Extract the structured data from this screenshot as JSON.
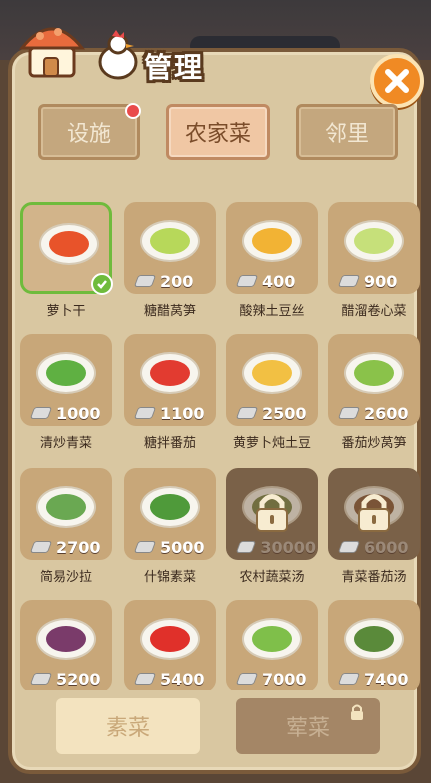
{
  "header": {
    "title": "管理",
    "close_icon": "close-icon"
  },
  "tabs": [
    {
      "label": "设施",
      "active": false,
      "has_notification": true
    },
    {
      "label": "农家菜",
      "active": true,
      "has_notification": false
    },
    {
      "label": "邻里",
      "active": false,
      "has_notification": false
    }
  ],
  "dishes": [
    {
      "name": "萝卜干",
      "price": "",
      "state": "selected",
      "food_color": "#e8532a"
    },
    {
      "name": "糖醋莴笋",
      "price": "200",
      "state": "available",
      "food_color": "#b7d85a"
    },
    {
      "name": "酸辣土豆丝",
      "price": "400",
      "state": "available",
      "food_color": "#f2b334"
    },
    {
      "name": "醋溜卷心菜",
      "price": "900",
      "state": "available",
      "food_color": "#c6e07a"
    },
    {
      "name": "清炒青菜",
      "price": "1000",
      "state": "available",
      "food_color": "#5fb042"
    },
    {
      "name": "糖拌番茄",
      "price": "1100",
      "state": "available",
      "food_color": "#e23b30"
    },
    {
      "name": "黄萝卜炖土豆",
      "price": "2500",
      "state": "available",
      "food_color": "#f2c043"
    },
    {
      "name": "番茄炒莴笋",
      "price": "2600",
      "state": "available",
      "food_color": "#8ac24a"
    },
    {
      "name": "简易沙拉",
      "price": "2700",
      "state": "available",
      "food_color": "#6aa852"
    },
    {
      "name": "什锦素菜",
      "price": "5000",
      "state": "available",
      "food_color": "#4f9a3a"
    },
    {
      "name": "农村蔬菜汤",
      "price": "30000",
      "state": "locked",
      "food_color": "#6a7a3a"
    },
    {
      "name": "青菜番茄汤",
      "price": "6000",
      "state": "locked",
      "food_color": "#7a4a2a"
    },
    {
      "name": "",
      "price": "5200",
      "state": "available",
      "food_color": "#7a3b6a"
    },
    {
      "name": "",
      "price": "5400",
      "state": "available",
      "food_color": "#e0302a"
    },
    {
      "name": "",
      "price": "7000",
      "state": "available",
      "food_color": "#7fbf4a"
    },
    {
      "name": "",
      "price": "7400",
      "state": "available",
      "food_color": "#5a8a3a"
    }
  ],
  "bottom": {
    "veg_label": "素菜",
    "meat_label": "荤菜",
    "meat_locked": true
  },
  "colors": {
    "accent": "#f08a24",
    "selected": "#6fbb3c",
    "panel": "#d9c7a1"
  }
}
